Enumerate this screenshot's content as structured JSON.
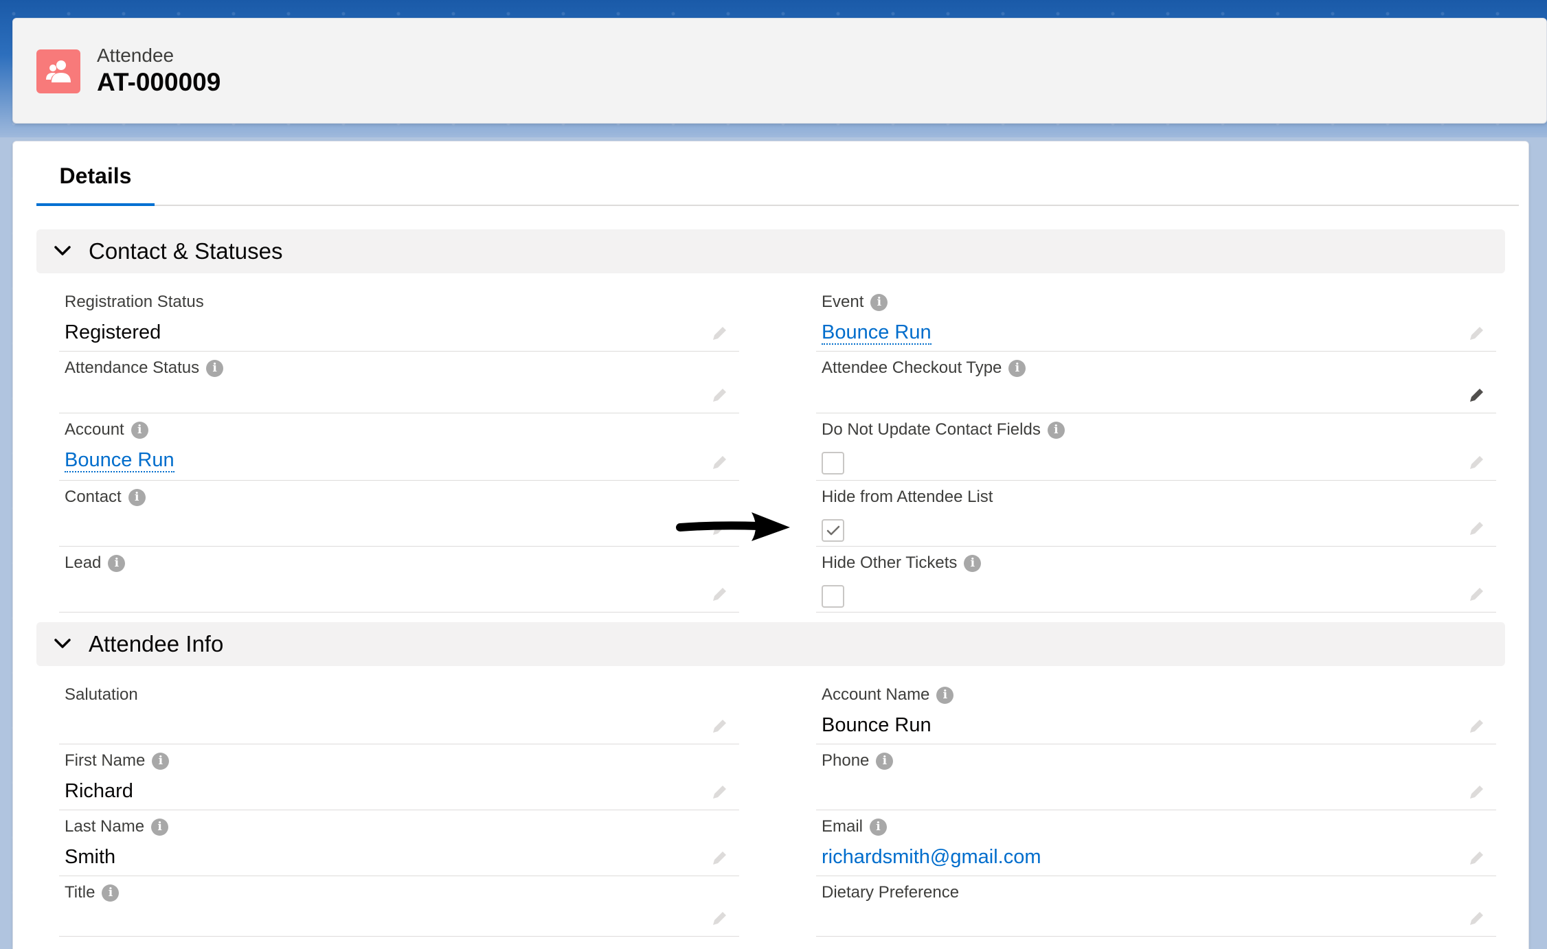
{
  "header": {
    "record_type": "Attendee",
    "record_name": "AT-000009"
  },
  "tabs": {
    "details": "Details"
  },
  "sections": {
    "contact": {
      "title": "Contact & Statuses",
      "left": [
        {
          "label": "Registration Status",
          "value": "Registered"
        },
        {
          "label": "Attendance Status",
          "value": ""
        },
        {
          "label": "Account",
          "value": "Bounce Run"
        },
        {
          "label": "Contact",
          "value": ""
        },
        {
          "label": "Lead",
          "value": ""
        }
      ],
      "right": [
        {
          "label": "Event",
          "value": "Bounce Run"
        },
        {
          "label": "Attendee Checkout Type",
          "value": ""
        },
        {
          "label": "Do Not Update Contact Fields",
          "checked": false
        },
        {
          "label": "Hide from Attendee List",
          "checked": true
        },
        {
          "label": "Hide Other Tickets",
          "checked": false
        }
      ]
    },
    "attendee": {
      "title": "Attendee Info",
      "left": [
        {
          "label": "Salutation",
          "value": ""
        },
        {
          "label": "First Name",
          "value": "Richard"
        },
        {
          "label": "Last Name",
          "value": "Smith"
        },
        {
          "label": "Title",
          "value": ""
        }
      ],
      "right": [
        {
          "label": "Account Name",
          "value": "Bounce Run"
        },
        {
          "label": "Phone",
          "value": ""
        },
        {
          "label": "Email",
          "value": "richardsmith@gmail.com"
        },
        {
          "label": "Dietary Preference",
          "value": ""
        }
      ]
    }
  },
  "icons": {
    "record": "attendee-icon",
    "info": "info-icon",
    "edit": "pencil-icon",
    "chevron": "chevron-down-icon",
    "annotation": "arrow-right-icon"
  },
  "info_glyph": "i",
  "colors": {
    "accent": "#0070d2",
    "link": "#006dcc",
    "record_icon": "#f87a7a"
  }
}
